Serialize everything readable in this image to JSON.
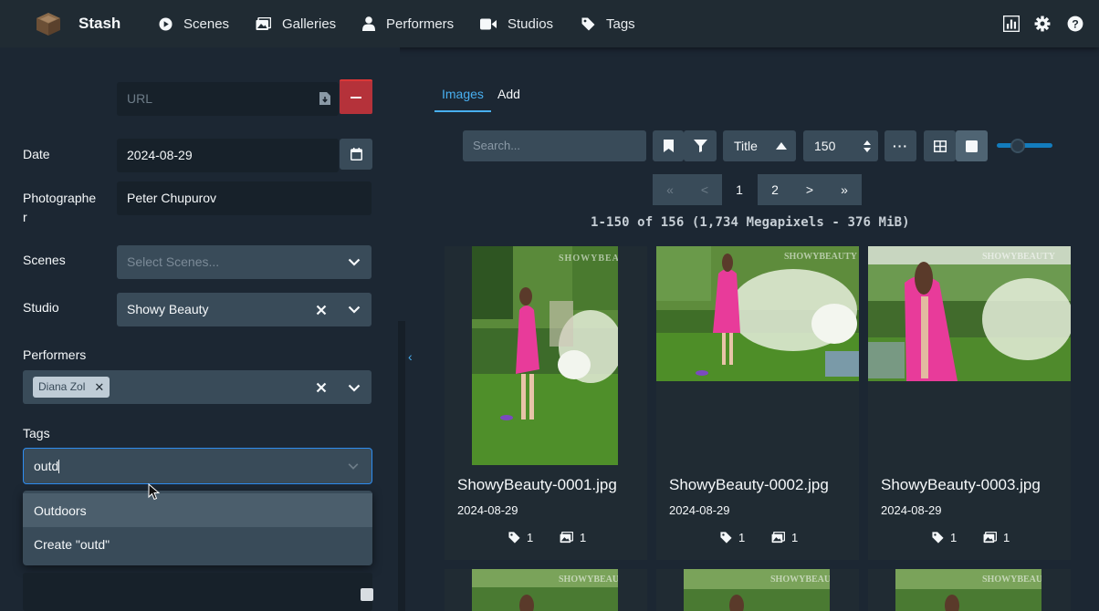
{
  "app": {
    "brand": "Stash"
  },
  "nav": {
    "items": [
      {
        "label": "Scenes",
        "icon": "play-circle-icon"
      },
      {
        "label": "Galleries",
        "icon": "images-icon"
      },
      {
        "label": "Performers",
        "icon": "user-icon"
      },
      {
        "label": "Studios",
        "icon": "video-icon"
      },
      {
        "label": "Tags",
        "icon": "tag-icon"
      }
    ],
    "right_icons": [
      "chart-icon",
      "gear-icon",
      "question-icon"
    ]
  },
  "form": {
    "url_placeholder": "URL",
    "date_label": "Date",
    "date_value": "2024-08-29",
    "photographer_label": "Photographe\nr",
    "photographer_value": "Peter Chupurov",
    "scenes_label": "Scenes",
    "scenes_placeholder": "Select Scenes...",
    "studio_label": "Studio",
    "studio_value": "Showy Beauty",
    "performers_label": "Performers",
    "performer_chip": "Diana Zol",
    "tags_label": "Tags",
    "tags_input": "outd",
    "tag_options": [
      "Outdoors",
      "Create \"outd\""
    ]
  },
  "tabs": [
    {
      "label": "Images",
      "active": true
    },
    {
      "label": "Add",
      "active": false
    }
  ],
  "toolbar": {
    "search_placeholder": "Search...",
    "sort_by": "Title",
    "per_page": "150",
    "more": "···"
  },
  "pagination": {
    "first": "«",
    "prev": "<",
    "pages": [
      "1",
      "2"
    ],
    "next": ">",
    "last": "»",
    "current": "1"
  },
  "summary": "1-150 of 156 (1,734 Megapixels - 376 MiB)",
  "images": [
    {
      "title": "ShowyBeauty-0001.jpg",
      "date": "2024-08-29",
      "tags": "1",
      "galleries": "1"
    },
    {
      "title": "ShowyBeauty-0002.jpg",
      "date": "2024-08-29",
      "tags": "1",
      "galleries": "1"
    },
    {
      "title": "ShowyBeauty-0003.jpg",
      "date": "2024-08-29",
      "tags": "1",
      "galleries": "1"
    }
  ],
  "watermark": "SHOWYBEAUTY",
  "colors": {
    "background": "#1c2733",
    "navbar": "#202b33",
    "input": "#394b59",
    "accent": "#48aff0",
    "danger": "#b5323a",
    "focus_border": "#2d8cf0"
  }
}
